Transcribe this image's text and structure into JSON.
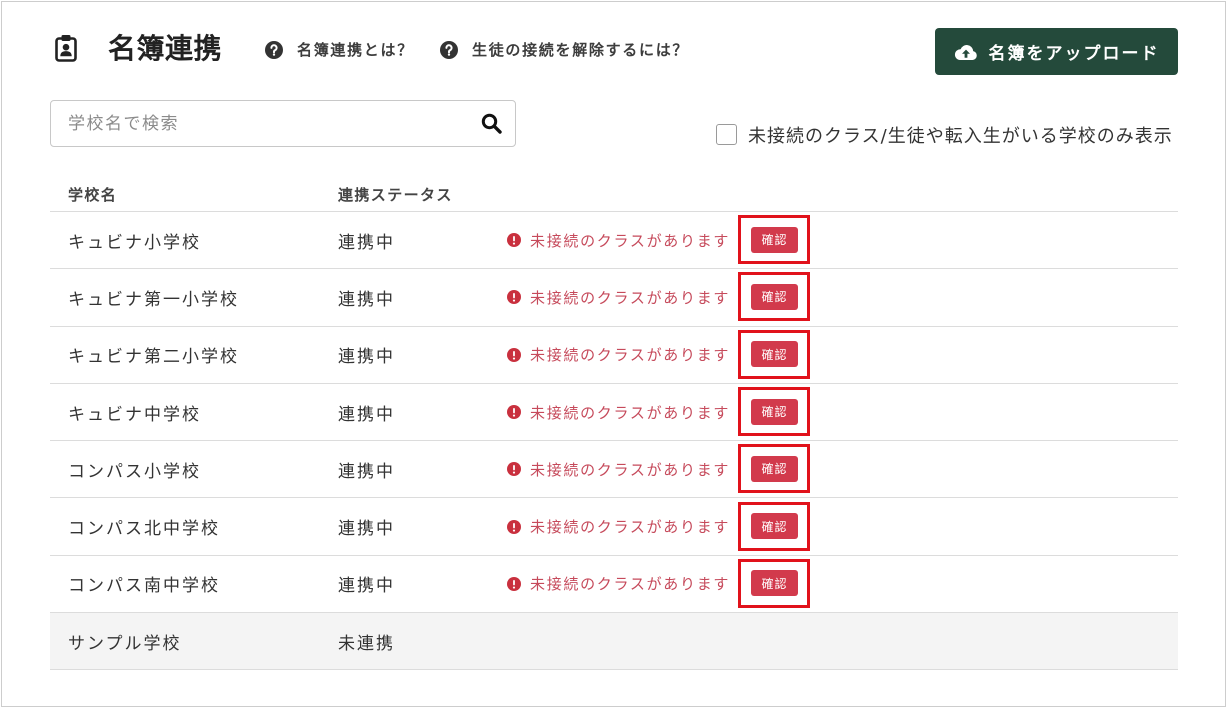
{
  "header": {
    "title": "名簿連携",
    "title_icon": "clipboard-user-icon",
    "help_links": [
      {
        "label": "名簿連携とは？",
        "icon": "question-circle-icon"
      },
      {
        "label": "生徒の接続を解除するには？",
        "icon": "question-circle-icon"
      }
    ],
    "upload_button": {
      "label": "名簿をアップロード",
      "icon": "cloud-upload-icon"
    }
  },
  "search": {
    "placeholder": "学校名で検索",
    "value": "",
    "icon": "search-icon"
  },
  "filter": {
    "label": "未接続のクラス/生徒や転入生がいる学校のみ表示",
    "checked": false
  },
  "table": {
    "columns": [
      "学校名",
      "連携ステータス"
    ],
    "warning_icon": "exclamation-circle-icon",
    "rows": [
      {
        "school": "キュビナ小学校",
        "status": "連携中",
        "warning": "未接続のクラスがあります",
        "action": "確認",
        "highlighted": true
      },
      {
        "school": "キュビナ第一小学校",
        "status": "連携中",
        "warning": "未接続のクラスがあります",
        "action": "確認",
        "highlighted": true
      },
      {
        "school": "キュビナ第二小学校",
        "status": "連携中",
        "warning": "未接続のクラスがあります",
        "action": "確認",
        "highlighted": true
      },
      {
        "school": "キュビナ中学校",
        "status": "連携中",
        "warning": "未接続のクラスがあります",
        "action": "確認",
        "highlighted": true
      },
      {
        "school": "コンパス小学校",
        "status": "連携中",
        "warning": "未接続のクラスがあります",
        "action": "確認",
        "highlighted": true
      },
      {
        "school": "コンパス北中学校",
        "status": "連携中",
        "warning": "未接続のクラスがあります",
        "action": "確認",
        "highlighted": true
      },
      {
        "school": "コンパス南中学校",
        "status": "連携中",
        "warning": "未接続のクラスがあります",
        "action": "確認",
        "highlighted": true
      },
      {
        "school": "サンプル学校",
        "status": "未連携"
      }
    ]
  },
  "colors": {
    "accent": "#244a3b",
    "warning_text": "#c64a5b",
    "warning_icon": "#c9303e",
    "action_button": "#d23a4c",
    "highlight": "#e1121b"
  }
}
